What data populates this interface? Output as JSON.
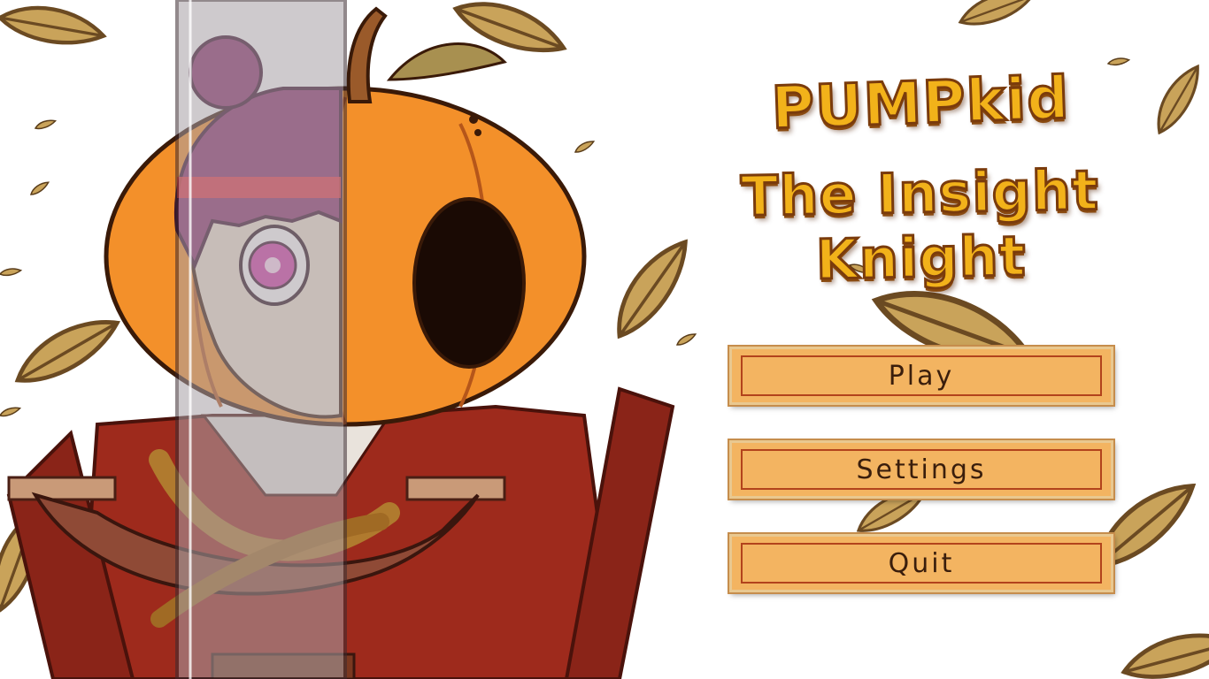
{
  "game": {
    "title_line1": "PUMPkid",
    "title_line2": "The Insight Knight"
  },
  "menu": {
    "play_label": "Play",
    "settings_label": "Settings",
    "quit_label": "Quit"
  },
  "colors": {
    "pumpkin_orange": "#f3902a",
    "button_fill": "#f3b461",
    "button_inner_border": "#b2431c",
    "cloak_red": "#9e2a1c",
    "hair_purple": "#8b2f6b",
    "leaf_tan": "#c9a35a",
    "title_gold": "#f2b21a"
  },
  "scene": {
    "character": "pumpkin-knight-character",
    "background_elements": [
      "falling-autumn-leaves"
    ]
  }
}
